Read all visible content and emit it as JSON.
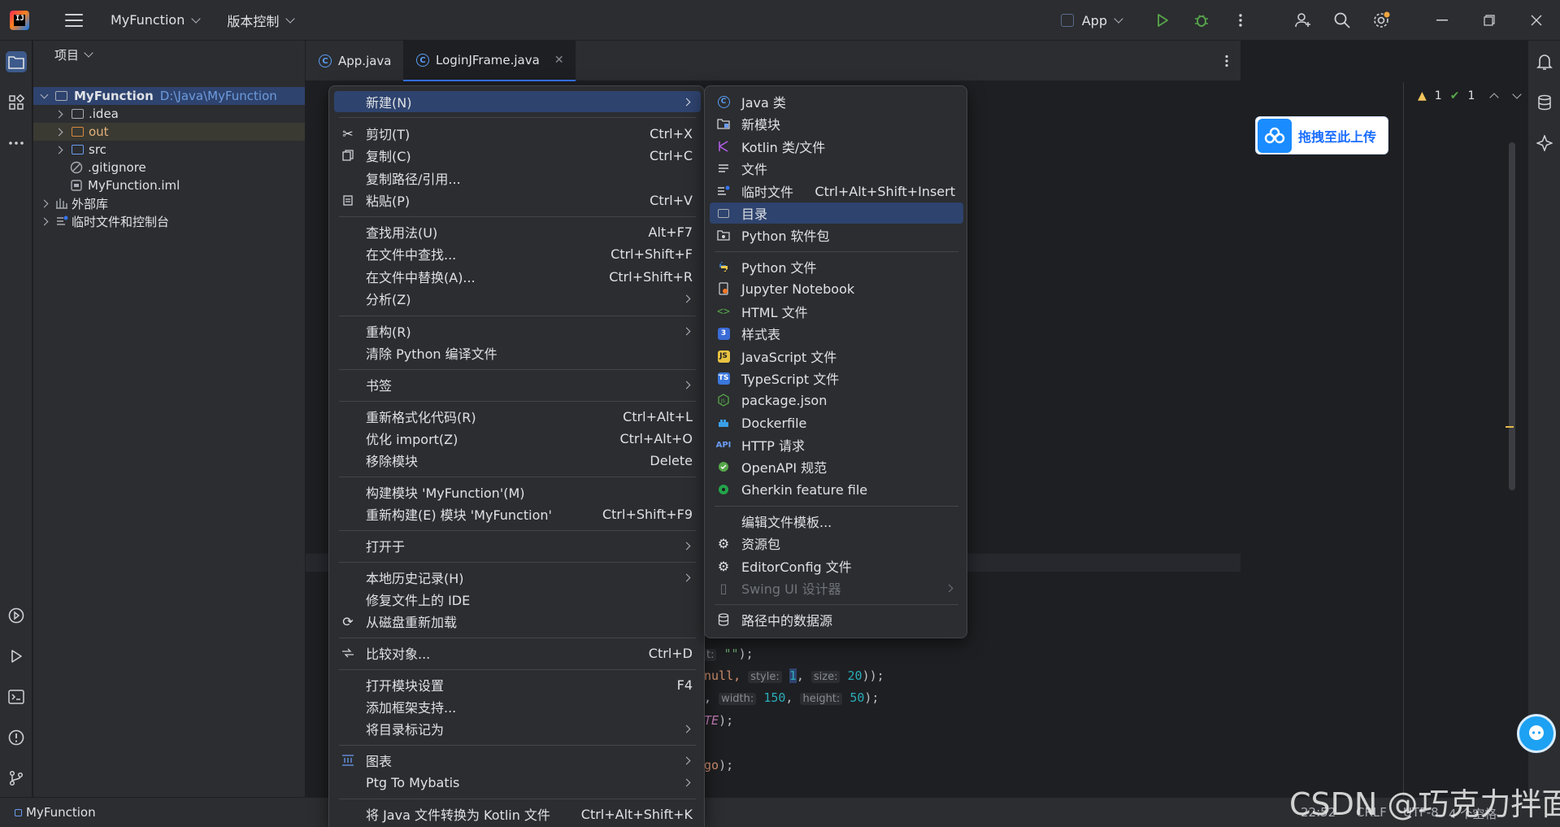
{
  "titlebar": {
    "project_name": "MyFunction",
    "vcs_label": "版本控制",
    "run_config": "App"
  },
  "project_panel": {
    "header": "项目",
    "root_name": "MyFunction",
    "root_path": "D:\\Java\\MyFunction",
    "items": [
      {
        "name": ".idea"
      },
      {
        "name": "out"
      },
      {
        "name": "src"
      },
      {
        "name": ".gitignore"
      },
      {
        "name": "MyFunction.iml"
      },
      {
        "name": "外部库"
      },
      {
        "name": "临时文件和控制台"
      }
    ]
  },
  "tabs": [
    {
      "label": "App.java"
    },
    {
      "label": "LoginJFrame.java"
    }
  ],
  "inspections": {
    "warnings": "1",
    "ok": "1"
  },
  "baidu_upload": "拖拽至此上传",
  "code_fragments": {
    "line1_hint": "t:",
    "line1_str": "\"\"",
    "line1_end": ");",
    "line2_a": "null,",
    "line2_hint1": "style:",
    "line2_num1": "1",
    "line2_hint2": "size:",
    "line2_num2": "20",
    "line2_end": "));",
    "line3_hint1": "width:",
    "line3_num1": "150",
    "line3_hint2": "height:",
    "line3_num2": "50",
    "line3_end": ");",
    "line4_ital": "TE",
    "line4_end": ");",
    "line5_a": "go",
    "line5_end": ");"
  },
  "context_menu": {
    "items": [
      {
        "label": "新建(N)",
        "shortcut": "",
        "submenu": true
      },
      {
        "label": "剪切(T)",
        "shortcut": "Ctrl+X"
      },
      {
        "label": "复制(C)",
        "shortcut": "Ctrl+C"
      },
      {
        "label": "复制路径/引用...",
        "shortcut": ""
      },
      {
        "label": "粘贴(P)",
        "shortcut": "Ctrl+V"
      },
      {
        "label": "查找用法(U)",
        "shortcut": "Alt+F7"
      },
      {
        "label": "在文件中查找...",
        "shortcut": "Ctrl+Shift+F"
      },
      {
        "label": "在文件中替换(A)...",
        "shortcut": "Ctrl+Shift+R"
      },
      {
        "label": "分析(Z)",
        "shortcut": "",
        "submenu": true
      },
      {
        "label": "重构(R)",
        "shortcut": "",
        "submenu": true
      },
      {
        "label": "清除 Python 编译文件",
        "shortcut": ""
      },
      {
        "label": "书签",
        "shortcut": "",
        "submenu": true
      },
      {
        "label": "重新格式化代码(R)",
        "shortcut": "Ctrl+Alt+L"
      },
      {
        "label": "优化 import(Z)",
        "shortcut": "Ctrl+Alt+O"
      },
      {
        "label": "移除模块",
        "shortcut": "Delete"
      },
      {
        "label": "构建模块 'MyFunction'(M)",
        "shortcut": ""
      },
      {
        "label": "重新构建(E) 模块 'MyFunction'",
        "shortcut": "Ctrl+Shift+F9"
      },
      {
        "label": "打开于",
        "shortcut": "",
        "submenu": true
      },
      {
        "label": "本地历史记录(H)",
        "shortcut": "",
        "submenu": true
      },
      {
        "label": "修复文件上的 IDE",
        "shortcut": ""
      },
      {
        "label": "从磁盘重新加载",
        "shortcut": ""
      },
      {
        "label": "比较对象...",
        "shortcut": "Ctrl+D"
      },
      {
        "label": "打开模块设置",
        "shortcut": "F4"
      },
      {
        "label": "添加框架支持...",
        "shortcut": ""
      },
      {
        "label": "将目录标记为",
        "shortcut": "",
        "submenu": true
      },
      {
        "label": "图表",
        "shortcut": "",
        "submenu": true
      },
      {
        "label": "Ptg To Mybatis",
        "shortcut": "",
        "submenu": true
      },
      {
        "label": "将 Java 文件转换为 Kotlin 文件",
        "shortcut": "Ctrl+Alt+Shift+K"
      }
    ]
  },
  "new_submenu": {
    "items": [
      {
        "label": "Java 类",
        "shortcut": ""
      },
      {
        "label": "新模块",
        "shortcut": ""
      },
      {
        "label": "Kotlin 类/文件",
        "shortcut": ""
      },
      {
        "label": "文件",
        "shortcut": ""
      },
      {
        "label": "临时文件",
        "shortcut": "Ctrl+Alt+Shift+Insert"
      },
      {
        "label": "目录",
        "shortcut": ""
      },
      {
        "label": "Python 软件包",
        "shortcut": ""
      },
      {
        "label": "Python 文件",
        "shortcut": ""
      },
      {
        "label": "Jupyter Notebook",
        "shortcut": ""
      },
      {
        "label": "HTML 文件",
        "shortcut": ""
      },
      {
        "label": "样式表",
        "shortcut": ""
      },
      {
        "label": "JavaScript 文件",
        "shortcut": ""
      },
      {
        "label": "TypeScript 文件",
        "shortcut": ""
      },
      {
        "label": "package.json",
        "shortcut": ""
      },
      {
        "label": "Dockerfile",
        "shortcut": ""
      },
      {
        "label": "HTTP 请求",
        "shortcut": ""
      },
      {
        "label": "OpenAPI 规范",
        "shortcut": ""
      },
      {
        "label": "Gherkin feature file",
        "shortcut": ""
      },
      {
        "label": "编辑文件模板...",
        "shortcut": ""
      },
      {
        "label": "资源包",
        "shortcut": ""
      },
      {
        "label": "EditorConfig 文件",
        "shortcut": ""
      },
      {
        "label": "Swing UI 设计器",
        "shortcut": ""
      },
      {
        "label": "路径中的数据源",
        "shortcut": ""
      }
    ]
  },
  "statusbar": {
    "project": "MyFunction",
    "position": "22:52",
    "line_sep": "CRLF",
    "encoding": "UTF-8",
    "indent": "4 个空格"
  },
  "watermark": "CSDN @巧克力拌面",
  "colors": {
    "accent": "#3574f0",
    "selection": "#2e436e",
    "menu_bg": "#2b2d30",
    "editor_bg": "#1e1f22"
  }
}
